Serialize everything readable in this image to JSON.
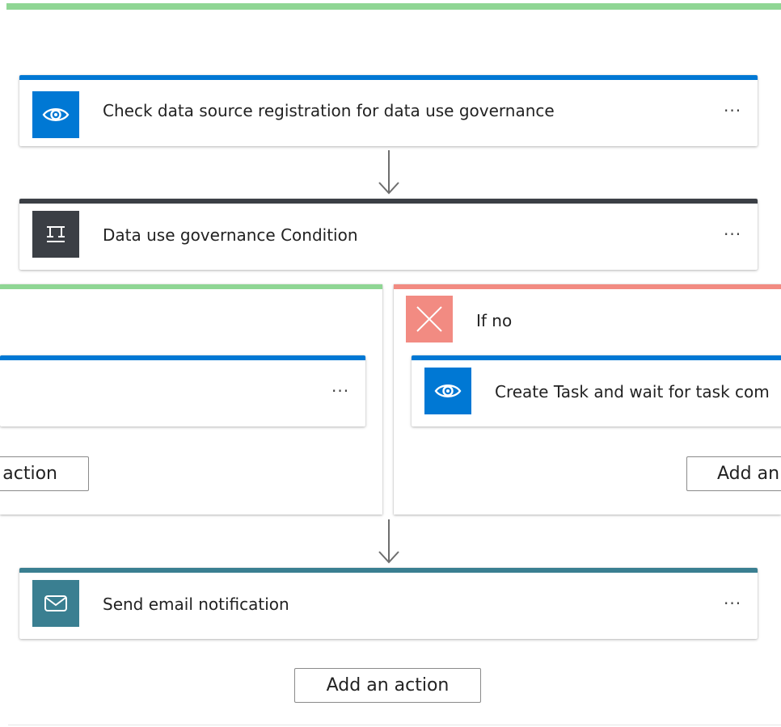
{
  "colors": {
    "success_green": "#8fd694",
    "action_blue": "#0078d4",
    "condition_gray": "#3b3f45",
    "failure_red": "#f28b82",
    "email_teal": "#3a7f91"
  },
  "steps": {
    "check_registration": {
      "title": "Check data source registration for data use governance",
      "icon": "eye-icon",
      "menu": "···"
    },
    "condition": {
      "title": "Data use governance Condition",
      "icon": "condition-icon",
      "menu": "···"
    },
    "send_email": {
      "title": "Send email notification",
      "icon": "mail-icon",
      "menu": "···"
    }
  },
  "branches": {
    "if_yes": {
      "card_menu": "···",
      "add_action_label": "action"
    },
    "if_no": {
      "label": "If no",
      "card_title": "Create Task and wait for task com",
      "card_icon": "eye-icon",
      "add_action_label": "Add an"
    }
  },
  "footer": {
    "add_action_label": "Add an action"
  }
}
